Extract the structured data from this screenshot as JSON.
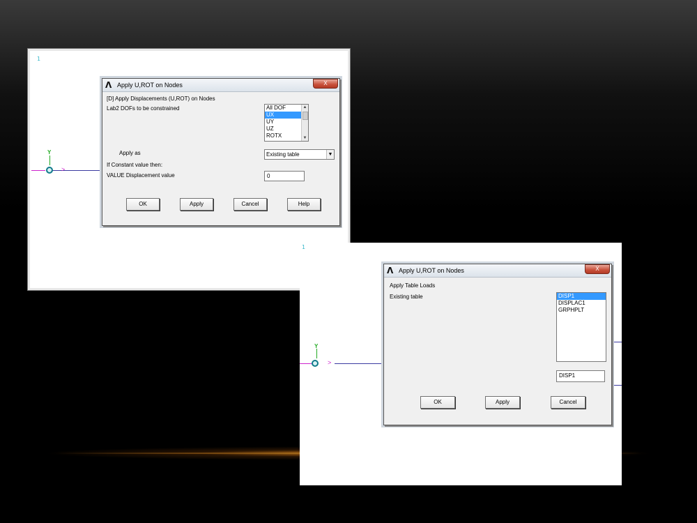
{
  "viewport1": {
    "axis_label": "1"
  },
  "viewport2": {
    "axis_label": "1"
  },
  "dialog1": {
    "title": "Apply U,ROT on Nodes",
    "close_label": "X",
    "header": "[D]  Apply Displacements (U,ROT) on Nodes",
    "lab2_label": "Lab2   DOFs to be constrained",
    "dof_options": [
      "All DOF",
      "UX",
      "UY",
      "UZ",
      "ROTX"
    ],
    "dof_selected": "UX",
    "apply_as_label": "Apply as",
    "apply_as_value": "Existing table",
    "if_constant_label": "If Constant value then:",
    "value_label": "VALUE   Displacement value",
    "value_input": "0",
    "buttons": {
      "ok": "OK",
      "apply": "Apply",
      "cancel": "Cancel",
      "help": "Help"
    }
  },
  "dialog2": {
    "title": "Apply U,ROT on Nodes",
    "close_label": "X",
    "header": "Apply Table Loads",
    "existing_table_label": "Existing table",
    "table_options": [
      "DISP1",
      "DISPLAC1",
      "GRPHPLT"
    ],
    "table_selected": "DISP1",
    "table_input": "DISP1",
    "buttons": {
      "ok": "OK",
      "apply": "Apply",
      "cancel": "Cancel"
    }
  }
}
